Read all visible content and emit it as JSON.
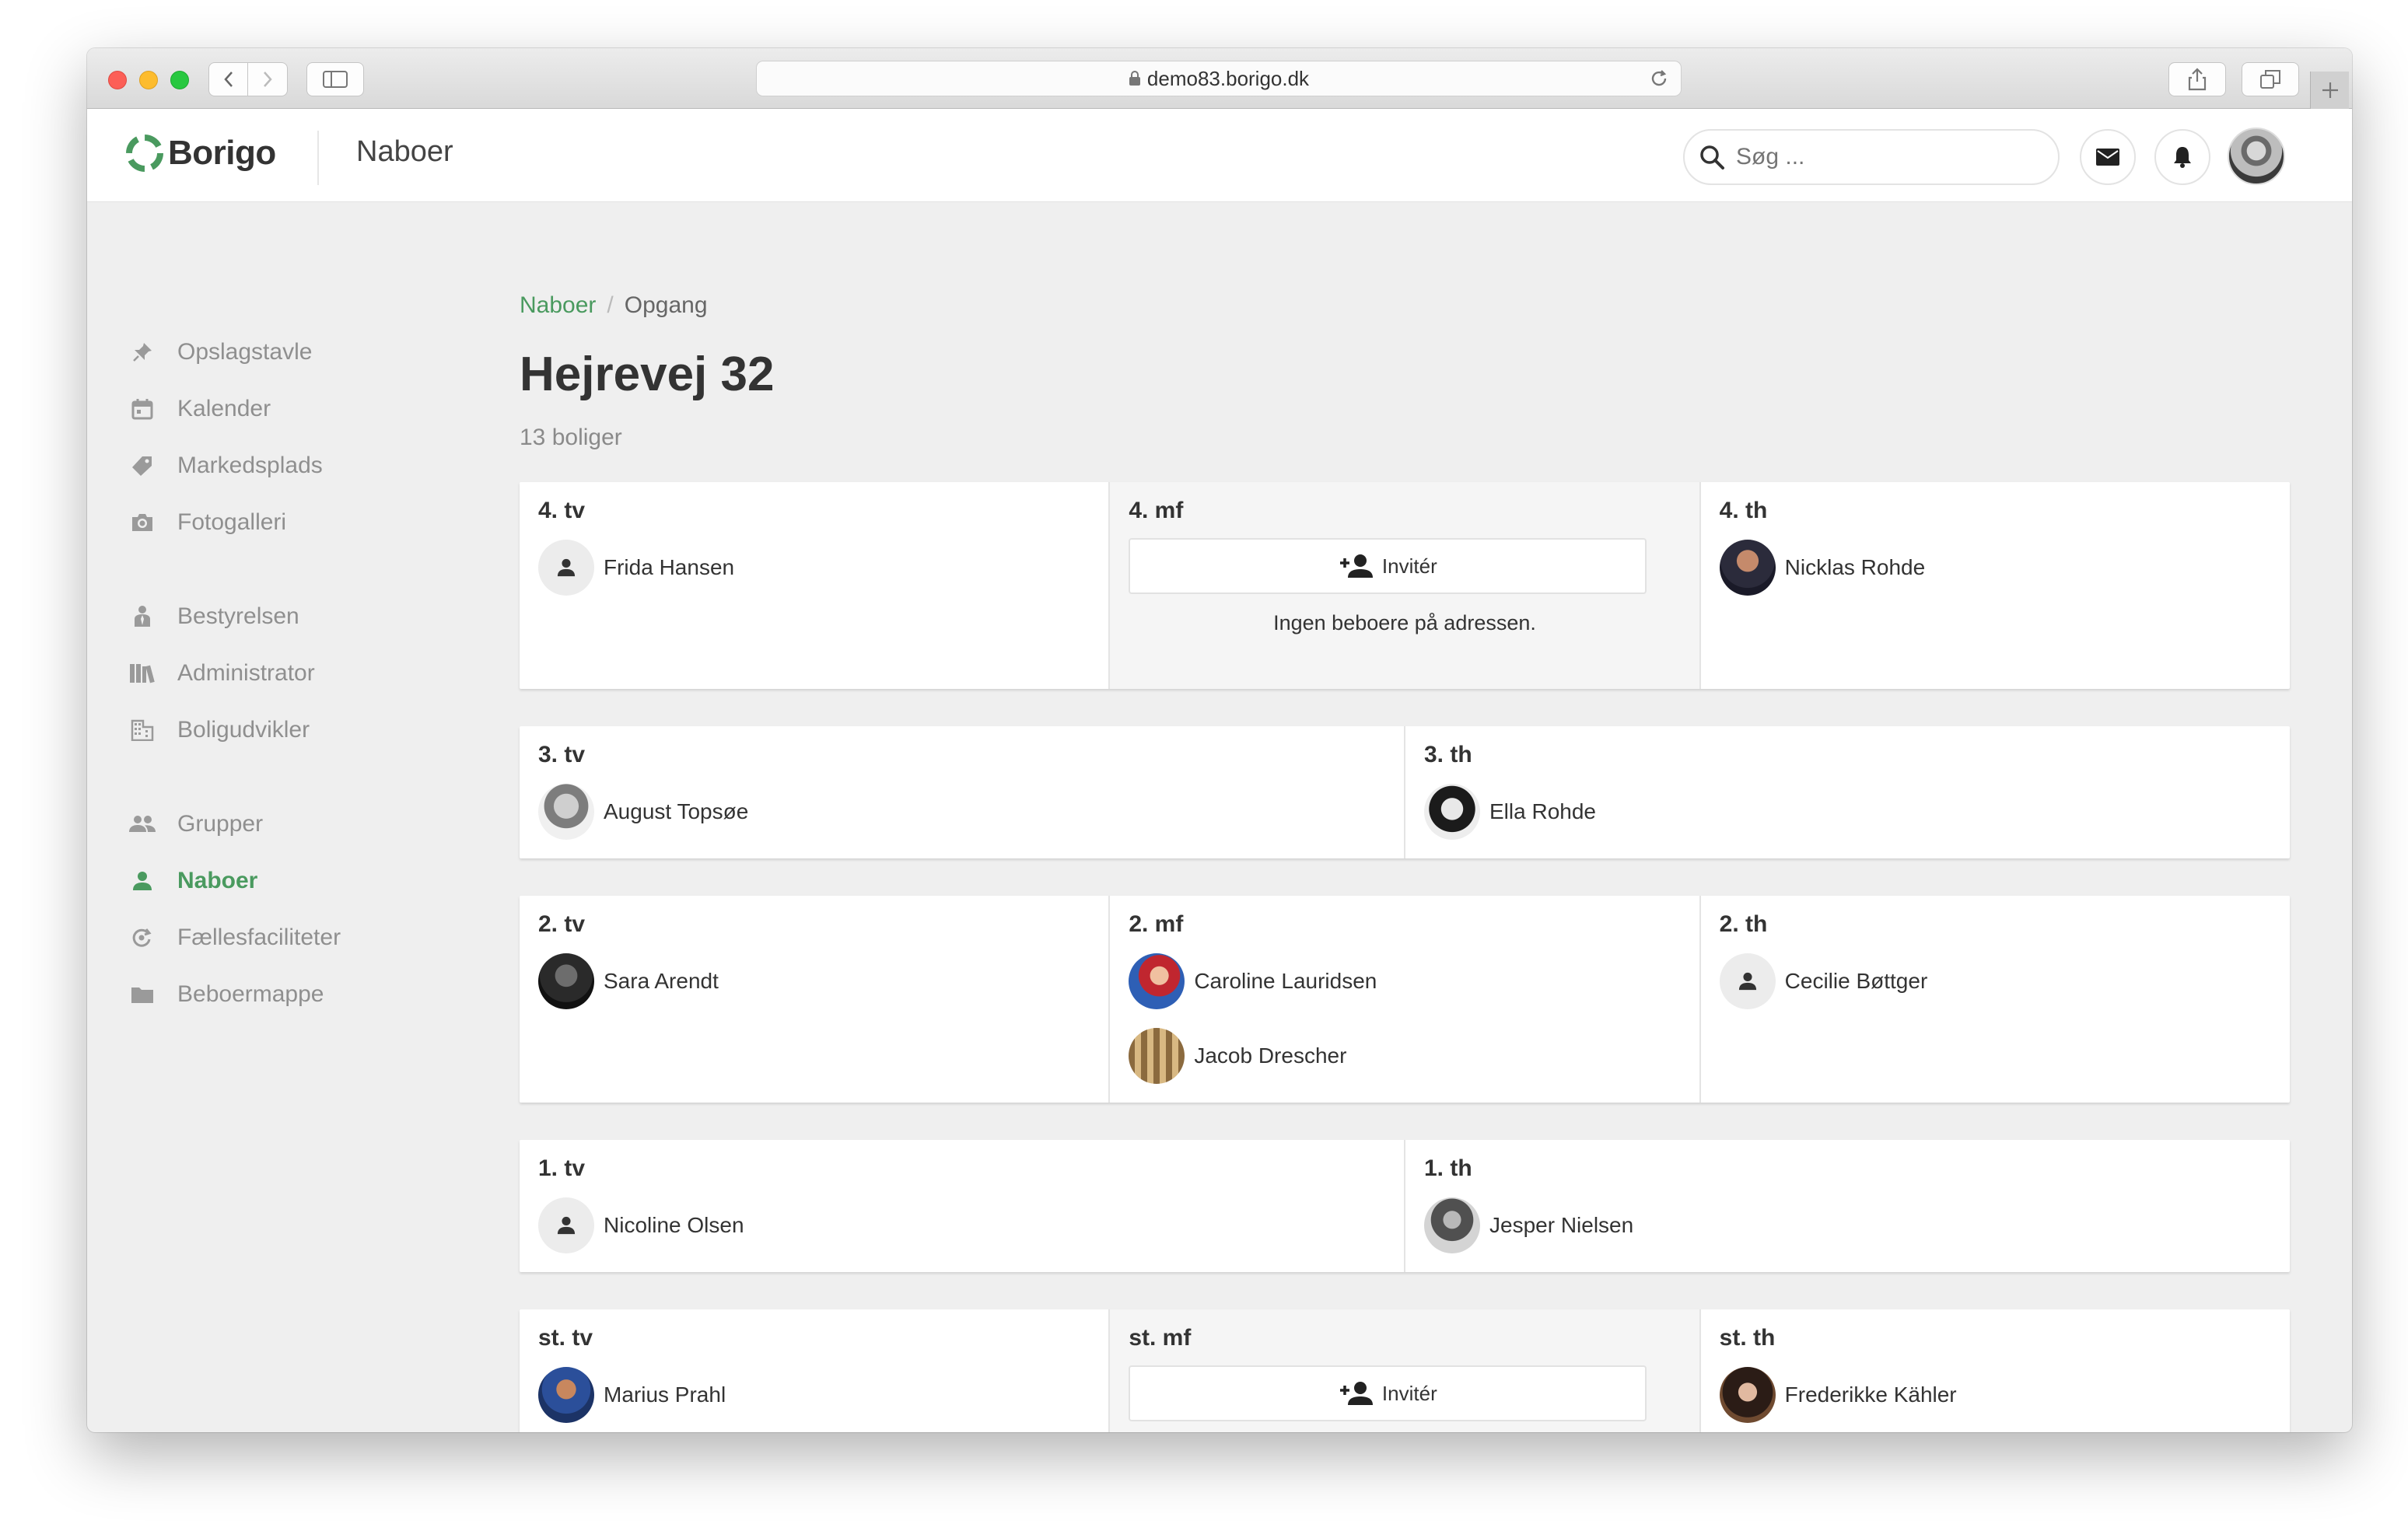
{
  "browser": {
    "url": "demo83.borigo.dk"
  },
  "header": {
    "logo_text": "Borigo",
    "section_title": "Naboer",
    "search_placeholder": "Søg ..."
  },
  "nav": {
    "items": [
      {
        "label": "Opslagstavle",
        "icon": "pin-icon"
      },
      {
        "label": "Kalender",
        "icon": "calendar-icon"
      },
      {
        "label": "Markedsplads",
        "icon": "tag-icon"
      },
      {
        "label": "Fotogalleri",
        "icon": "camera-icon"
      },
      {
        "label": "Bestyrelsen",
        "icon": "board-icon"
      },
      {
        "label": "Administrator",
        "icon": "books-icon"
      },
      {
        "label": "Boligudvikler",
        "icon": "building-icon"
      },
      {
        "label": "Grupper",
        "icon": "group-icon"
      },
      {
        "label": "Naboer",
        "icon": "person-icon",
        "active": true
      },
      {
        "label": "Fællesfaciliteter",
        "icon": "facilities-icon"
      },
      {
        "label": "Beboermappe",
        "icon": "folder-icon"
      }
    ]
  },
  "breadcrumb": {
    "parent": "Naboer",
    "separator": "/",
    "current": "Opgang"
  },
  "page": {
    "title": "Hejrevej 32",
    "subtitle": "13 boliger"
  },
  "floors": [
    {
      "units": [
        {
          "label": "4. tv",
          "residents": [
            "Frida Hansen"
          ]
        },
        {
          "label": "4. mf",
          "invite_label": "Invitér",
          "empty_note": "Ingen beboere på adressen."
        },
        {
          "label": "4. th",
          "residents": [
            "Nicklas Rohde"
          ]
        }
      ]
    },
    {
      "units": [
        {
          "label": "3. tv",
          "residents": [
            "August Topsøe"
          ]
        },
        {
          "label": "3. th",
          "residents": [
            "Ella Rohde"
          ]
        }
      ]
    },
    {
      "units": [
        {
          "label": "2. tv",
          "residents": [
            "Sara Arendt"
          ]
        },
        {
          "label": "2. mf",
          "residents": [
            "Caroline Lauridsen",
            "Jacob Drescher"
          ]
        },
        {
          "label": "2. th",
          "residents": [
            "Cecilie Bøttger"
          ]
        }
      ]
    },
    {
      "units": [
        {
          "label": "1. tv",
          "residents": [
            "Nicoline Olsen"
          ]
        },
        {
          "label": "1. th",
          "residents": [
            "Jesper Nielsen"
          ]
        }
      ]
    },
    {
      "units": [
        {
          "label": "st. tv",
          "residents": [
            "Marius Prahl"
          ]
        },
        {
          "label": "st. mf",
          "invite_label": "Invitér"
        },
        {
          "label": "st. th",
          "residents": [
            "Frederikke Kähler"
          ]
        }
      ]
    }
  ],
  "colors": {
    "accent": "#4a9a5f"
  }
}
